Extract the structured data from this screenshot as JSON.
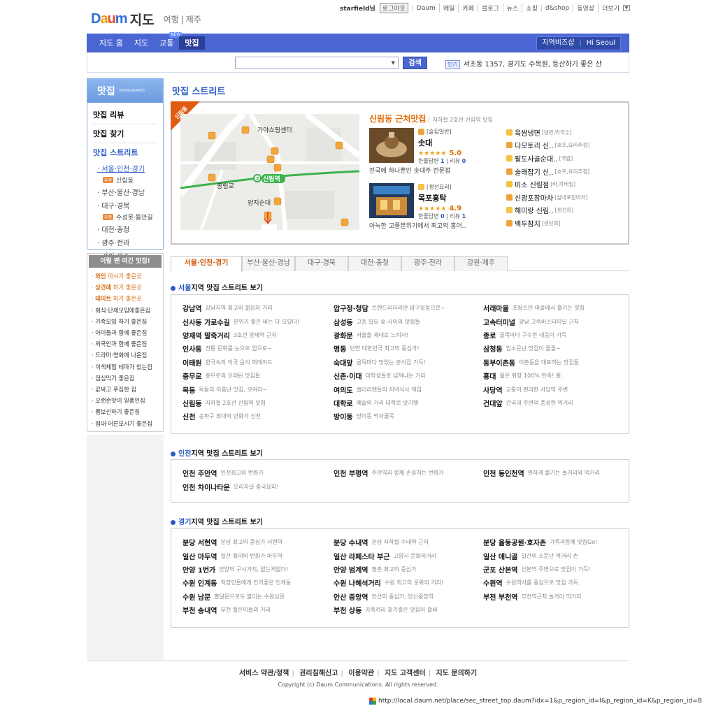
{
  "logo": {
    "brand": "Daum",
    "product": "지도",
    "sub1": "여행",
    "sub2": "제주"
  },
  "topnav": {
    "user": "starfield님",
    "login": "로그아웃",
    "items": [
      "Daum",
      "메일",
      "카페",
      "블로그",
      "뉴스",
      "쇼핑",
      "d&shop",
      "동영상"
    ],
    "more": "더보기"
  },
  "mainnav": {
    "tabs": [
      "지도 홈",
      "지도",
      "교통",
      "맛집"
    ],
    "new_badge": "NEW",
    "right": [
      "지역비즈샵",
      "Hi Seoul"
    ]
  },
  "search": {
    "placeholder": "",
    "button": "검색",
    "hot_tag": "인기",
    "hot_text": "서초동 1357, 경기도 수목원, 등산하기 좋은 산"
  },
  "sidebar": {
    "title": "맛집",
    "title_en": "RESTAURANTS",
    "menu": [
      "맛집 리뷰",
      "맛집 찾기",
      "맛집 스트리트"
    ],
    "regions": [
      "서울·인천·경기",
      "부산·울산·경남",
      "대구·경북",
      "대전·충청",
      "광주·전라",
      "강원·제주"
    ],
    "sub_tag": "추천",
    "sub1": "신림동",
    "sub2": "수성못·들안길"
  },
  "theme": {
    "title": "이럴 땐 여긴 맛집!",
    "items": [
      {
        "b": "와인",
        "t": " 마시기 좋은곳"
      },
      {
        "b": "상견례",
        "t": " 하기 좋은곳"
      },
      {
        "b": "데이트",
        "t": " 하기 좋은곳"
      },
      {
        "b": "",
        "t": "회식·단체모임에좋은집"
      },
      {
        "b": "",
        "t": "가족모임 하기 좋은집"
      },
      {
        "b": "",
        "t": "아이들과 함께 좋은집"
      },
      {
        "b": "",
        "t": "외국인과 함께 좋은집"
      },
      {
        "b": "",
        "t": "드라마·영화에 나온집"
      },
      {
        "b": "",
        "t": "이색체험 테마가 있는집"
      },
      {
        "b": "",
        "t": "점심먹기 좋은집"
      },
      {
        "b": "",
        "t": "값싸고 푸짐한 집"
      },
      {
        "b": "",
        "t": "오랜손맛이 일품인집"
      },
      {
        "b": "",
        "t": "몸보신하기 좋은집"
      },
      {
        "b": "",
        "t": "접대·어른모시기 좋은집"
      }
    ]
  },
  "page_title": {
    "a": "맛집",
    "b": " 스트리트"
  },
  "feature": {
    "ribbon": "신림동",
    "map_labels": [
      "가야쇼핑센터",
      "봉림교",
      "신림역",
      "양지순대",
      "2"
    ],
    "head_a": "신림동",
    "head_b": " 근처맛집",
    "head_desc": "지하철 2호선 신림역 맛집",
    "rest1": {
      "cat": "[술집일반]",
      "name": "솟대",
      "stars": "★★★★★",
      "score": "5.0",
      "reply_label": "한줄답변 ",
      "reply": "1",
      "review_label": " | 리뷰 ",
      "review": "0",
      "tagline": "전국에 하나뿐인 솟대주 전문점"
    },
    "rest2": {
      "cat": "[생선요리]",
      "name": "목포홍탁",
      "stars": "★★★★★",
      "score": "4.9",
      "reply_label": "한줄답변 ",
      "reply": "0",
      "review_label": " | 리뷰 ",
      "review": "1",
      "tagline": "아늑한 고풍분위기에서 최고의 홍어.."
    },
    "list": [
      {
        "name": "육쌈냉면",
        "cat": "[냉면,막국수]"
      },
      {
        "name": "다모토리 신..",
        "cat": "[호프,요리주점]"
      },
      {
        "name": "팔도사골순대..",
        "cat": "[국밥]"
      },
      {
        "name": "술래잡기 신..",
        "cat": "[호프,요리주점]"
      },
      {
        "name": "미소 신림점",
        "cat": "[바,칵테일]"
      },
      {
        "name": "신광포장마차",
        "cat": "[실내포장마차]"
      },
      {
        "name": "해미랑 신림..",
        "cat": "[생선회]"
      },
      {
        "name": "백두참치",
        "cat": "[생선회]"
      }
    ]
  },
  "region_tabs": [
    "서울·인천·경기",
    "부산·울산·경남",
    "대구·경북",
    "대전·충청",
    "광주·전라",
    "강원·제주"
  ],
  "sections": [
    {
      "h": "서울",
      "t": "지역 맛집 스트리트 보기",
      "cols": [
        [
          {
            "b": "강남역",
            "d": "강남지역 최고의 젊음의 거리"
          },
          {
            "b": "신사동 가로수길",
            "d": "분위기 좋은 바는 다 모였다!"
          },
          {
            "b": "양재역 말죽거리",
            "d": "3호선 양재역 근처"
          },
          {
            "b": "인사동",
            "d": "전통 문화를 눈으로 입으로~"
          },
          {
            "b": "이태원",
            "d": "한국속의 이국 음식 퍼레이드"
          },
          {
            "b": "충무로",
            "d": "충무로의 오래된 맛집들"
          },
          {
            "b": "목동",
            "d": "목동의 이름난 맛집, 모여라~"
          },
          {
            "b": "신림동",
            "d": "지하철 2호선 신림역 맛집"
          },
          {
            "b": "신천",
            "d": "송파구 최대의 번화가 신천"
          }
        ],
        [
          {
            "b": "압구정·청담",
            "d": "트렌드리더라면 압구정동으로~"
          },
          {
            "b": "삼성동",
            "d": "고층 빌딩 숲 사이의 맛집들"
          },
          {
            "b": "광화문",
            "d": "서울을 제대로 느끼자!"
          },
          {
            "b": "명동",
            "d": "단연 대한민국 최고의 중심가!"
          },
          {
            "b": "숙대앞",
            "d": "골목마다 맛있는 분식집 가득!"
          },
          {
            "b": "신촌·이대",
            "d": "대학생들로 넘쳐나는 거리"
          },
          {
            "b": "여의도",
            "d": "샐러리맨들의 저녁식사 책임"
          },
          {
            "b": "대학로",
            "d": "예술의 거리 대학로 맛기행"
          },
          {
            "b": "방이동",
            "d": "방이동 먹자골목"
          }
        ],
        [
          {
            "b": "서래마을",
            "d": "프랑스인 마을에서 즐기는 맛집"
          },
          {
            "b": "고속터미널",
            "d": "강남 고속버스터미널 근처"
          },
          {
            "b": "종로",
            "d": "골목마다 구수한 내음이 가득"
          },
          {
            "b": "삼청동",
            "d": "입소문난 맛집이 줄줄~"
          },
          {
            "b": "동부이촌동",
            "d": "이촌동을 대표하는 맛집들"
          },
          {
            "b": "홍대",
            "d": "젊은 취향 100% 만족! 홍.."
          },
          {
            "b": "사당역",
            "d": "교통이 편리한 사당역 주변"
          },
          {
            "b": "건대앞",
            "d": "건국대 주변의 풍성한 먹거리"
          }
        ]
      ]
    },
    {
      "h": "인천",
      "t": "지역 맛집 스트리트 보기",
      "cols": [
        [
          {
            "b": "인천 주안역",
            "d": "인천최고의 번화가"
          },
          {
            "b": "인천 차이나타운",
            "d": "오리지널 중국요리!"
          }
        ],
        [
          {
            "b": "인천 부평역",
            "d": "주안역과 함께 손꼽히는 번화가"
          }
        ],
        [
          {
            "b": "인천 동인천역",
            "d": "편하게 즐기는 놀거리와 먹거리"
          }
        ]
      ]
    },
    {
      "h": "경기",
      "t": "지역 맛집 스트리트 보기",
      "cols": [
        [
          {
            "b": "분당 서현역",
            "d": "분당 최고의 중심가 서현역"
          },
          {
            "b": "일산 마두역",
            "d": "일산 최대의 번화가 마두역"
          },
          {
            "b": "안양 1번가",
            "d": "안양의 구시가지, 없는게없다!"
          },
          {
            "b": "수원 인계동",
            "d": "직장인들에게 인기좋은 인계동"
          },
          {
            "b": "수원 남문",
            "d": "팔달문으로도 불리는 수원남문"
          },
          {
            "b": "부천 송내역",
            "d": "부천 젊은이들의 거리"
          }
        ],
        [
          {
            "b": "분당 수내역",
            "d": "분당 지하철 수내역 근처"
          },
          {
            "b": "일산 라페스타 부근",
            "d": "고양시 문화의거리"
          },
          {
            "b": "안양 범계역",
            "d": "평촌 최고의 중심가"
          },
          {
            "b": "수원 나혜석거리",
            "d": "수원 최고의 문화의 거리!"
          },
          {
            "b": "안산 중앙역",
            "d": "안산의 중심가, 안산중앙역"
          },
          {
            "b": "부천 상동",
            "d": "가족끼리 찾기좋은 맛집이 즐비"
          }
        ],
        [
          {
            "b": "분당 율동공원·호자촌",
            "d": "가족과함께 맛집Go!"
          },
          {
            "b": "일산 애니골",
            "d": "일산의 소문난 먹거리 촌"
          },
          {
            "b": "군포 산본역",
            "d": "산본역 주변으로 맛집이 가득!"
          },
          {
            "b": "수원역",
            "d": "수원역사를 중심으로 맛집 가득"
          },
          {
            "b": "부천 부천역",
            "d": "부천역근처 놀거리 먹거리"
          }
        ]
      ]
    }
  ],
  "footer": {
    "links": [
      "서비스 약관/정책",
      "권리침해신고",
      "이용약관",
      "지도 고객센터",
      "지도 문의하기"
    ],
    "copy": "Copyright (c) Daum Communications. All rights reserved."
  },
  "status_url": "http://local.daum.net/place/sec_street_top.daum?idx=1&p_region_id=I&p_region_id=K&p_region_id=B"
}
